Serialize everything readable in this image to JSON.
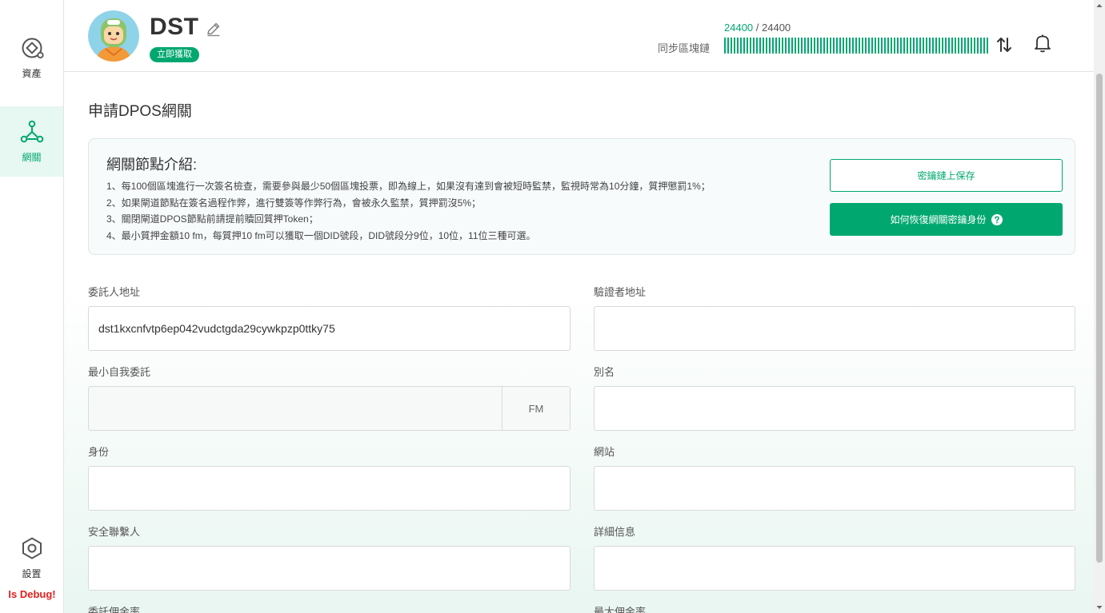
{
  "sidebar": {
    "items": [
      {
        "label": "資產",
        "icon": "assets-icon"
      },
      {
        "label": "網關",
        "icon": "gateway-icon",
        "active": true
      },
      {
        "label": "設置",
        "icon": "settings-icon"
      }
    ],
    "debug": "Is Debug!"
  },
  "header": {
    "app_name": "DST",
    "claim_label": "立即獲取",
    "sync": {
      "current": "24400",
      "separator": " / ",
      "total": "24400",
      "label": "同步區塊鏈",
      "progress": 1.0
    }
  },
  "main": {
    "title": "申請DPOS網關",
    "intro": {
      "title": "網關節點介紹:",
      "lines": [
        "1、每100個區塊進行一次簽名檢查，需要參與最少50個區塊投票，即為線上，如果沒有達到會被短時監禁，監視時常為10分鐘，質押懲罰1%；",
        "2、如果閘道節點在簽名過程作弊，進行雙簽等作弊行為，會被永久監禁，質押罰沒5%；",
        "3、關閉閘道DPOS節點前請提前贖回質押Token；",
        "4、最小質押金額10 fm，每質押10 fm可以獲取一個DID號段，DID號段分9位，10位，11位三種可選。"
      ],
      "btn_save": "密鑰鏈上保存",
      "btn_recover": "如何恢復網關密鑰身份"
    },
    "form": {
      "delegator_label": "委託人地址",
      "delegator_value": "dst1kxcnfvtp6ep042vudctgda29cywkpzp0ttky75",
      "validator_label": "驗證者地址",
      "validator_value": "",
      "min_self_label": "最小自我委託",
      "min_self_unit": "FM",
      "alias_label": "別名",
      "identity_label": "身份",
      "website_label": "網站",
      "security_label": "安全聯繫人",
      "details_label": "詳細信息",
      "commission_label": "委託佣金率",
      "max_commission_label": "最大佣金率"
    }
  },
  "colors": {
    "accent": "#00a870",
    "active_bg": "#e7f7f1",
    "debug": "#e0201e"
  }
}
